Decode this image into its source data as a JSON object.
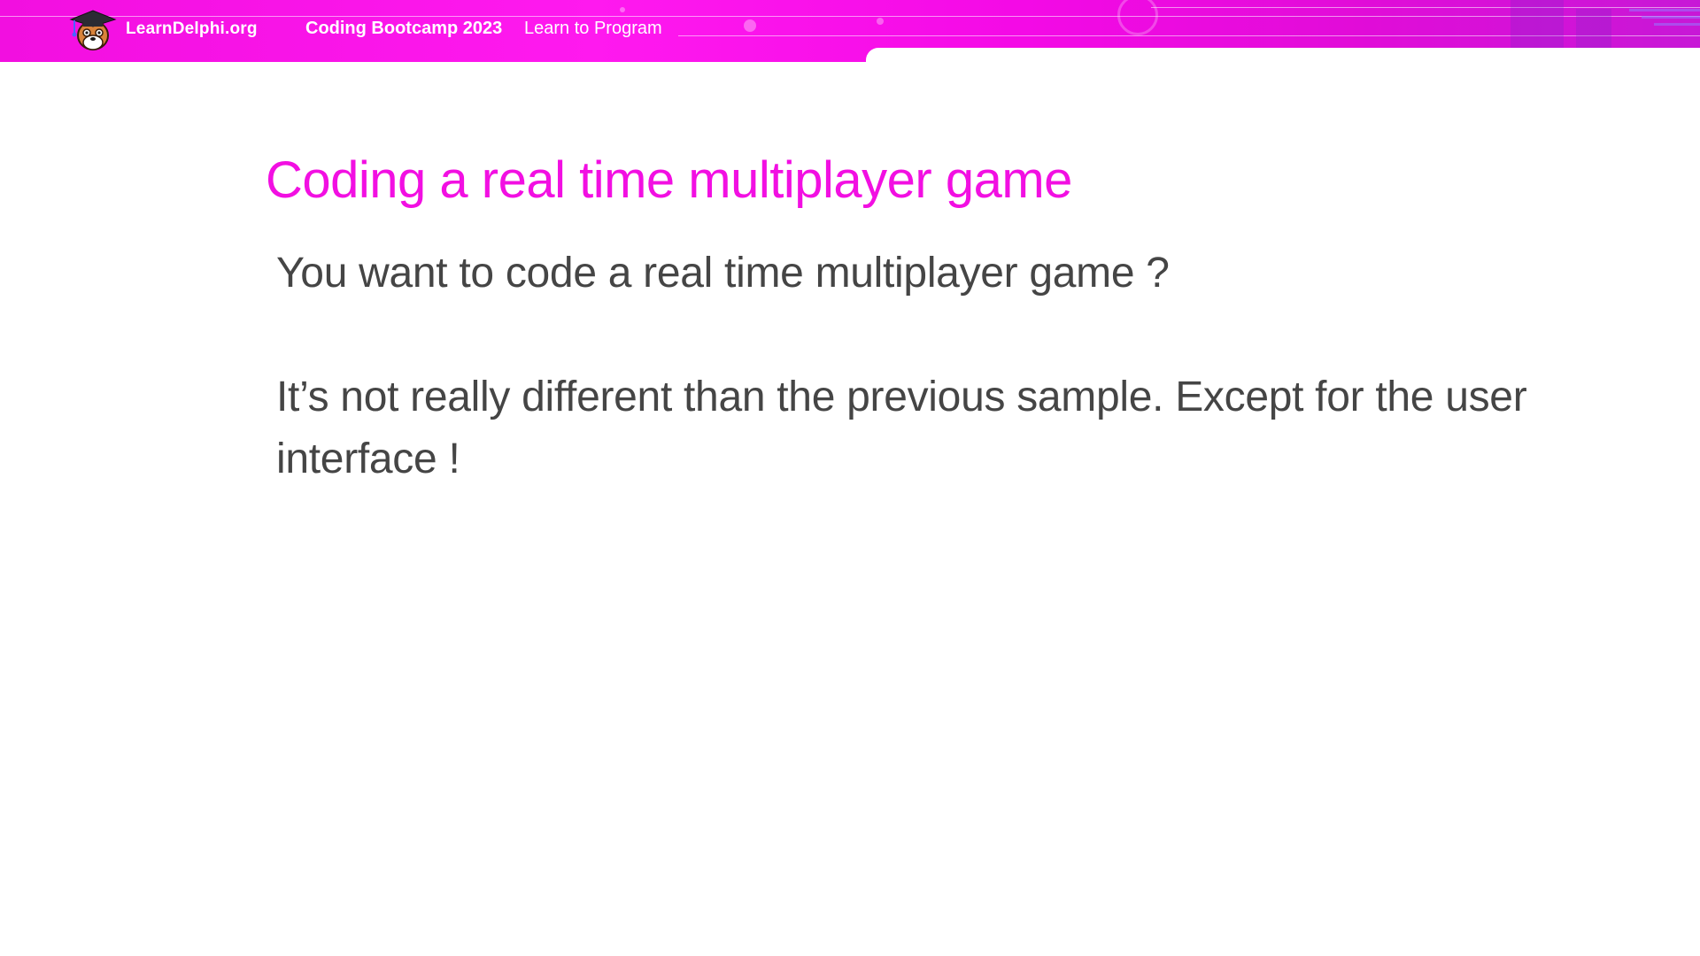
{
  "header": {
    "brand": "LearnDelphi.org",
    "event_title": "Coding Bootcamp 2023",
    "event_tagline": "Learn to Program",
    "logo_icon": "graduate-mascot-icon",
    "accent_color": "#f20fe2"
  },
  "slide": {
    "title": "Coding a real time multiplayer game",
    "paragraphs": [
      "You want to code a real time multiplayer game ?",
      "It’s not really different than the previous sample. Except for the user interface !"
    ],
    "text_color": "#454545"
  }
}
